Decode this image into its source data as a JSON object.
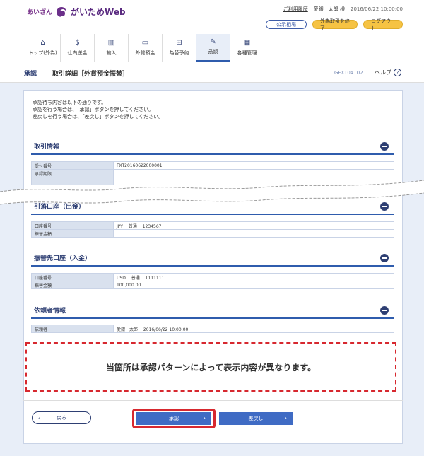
{
  "header": {
    "brand_small": "あいざん",
    "brand": "がいためWeb",
    "history_link": "ご利用履歴",
    "user_name": "愛銀　太郎 様",
    "datetime": "2016/06/22 10:00:00",
    "rates_button": "公示相場",
    "end_button": "外為取引を終了",
    "logout_button": "ログアウト"
  },
  "nav": {
    "items": [
      {
        "label": "トップ(外為)",
        "icon": "home-icon"
      },
      {
        "label": "仕向送金",
        "icon": "remittance-icon"
      },
      {
        "label": "輸入",
        "icon": "import-icon"
      },
      {
        "label": "外貨預金",
        "icon": "deposit-icon"
      },
      {
        "label": "為替予約",
        "icon": "forward-icon"
      },
      {
        "label": "承認",
        "icon": "approve-icon"
      },
      {
        "label": "各種管理",
        "icon": "admin-icon"
      }
    ]
  },
  "breadcrumb": {
    "section": "承認",
    "title": "取引詳細［外貨預金振替］",
    "screen_code": "GFXT04102",
    "help": "ヘルプ"
  },
  "intro": [
    "承認待ち内容は以下の通りです。",
    "承認を行う場合は、「承認」ボタンを押してください。",
    "差戻しを行う場合は、「差戻し」ボタンを押してください。"
  ],
  "sections": {
    "transaction": {
      "title": "取引情報",
      "rows": [
        {
          "label": "受付番号",
          "value": "FXT20160622000001"
        },
        {
          "label": "承認期限",
          "value": ""
        }
      ]
    },
    "debit": {
      "title": "引落口座（出金）",
      "rows": [
        {
          "label": "口座番号",
          "value": "JPY　 普通　 1234567"
        },
        {
          "label": "振替金額",
          "value": ""
        }
      ]
    },
    "credit": {
      "title": "振替先口座（入金）",
      "rows": [
        {
          "label": "口座番号",
          "value": "USD　 普通　 1111111"
        },
        {
          "label": "振替金額",
          "value": "100,000.00"
        }
      ]
    },
    "requester": {
      "title": "依頼者情報",
      "rows": [
        {
          "label": "依頼者",
          "value": "愛銀　太郎　 2016/06/22 10:00:00"
        }
      ]
    }
  },
  "note": "当箇所は承認パターンによって表示内容が異なります。",
  "buttons": {
    "back": "戻る",
    "approve": "承認",
    "reject": "差戻し"
  }
}
